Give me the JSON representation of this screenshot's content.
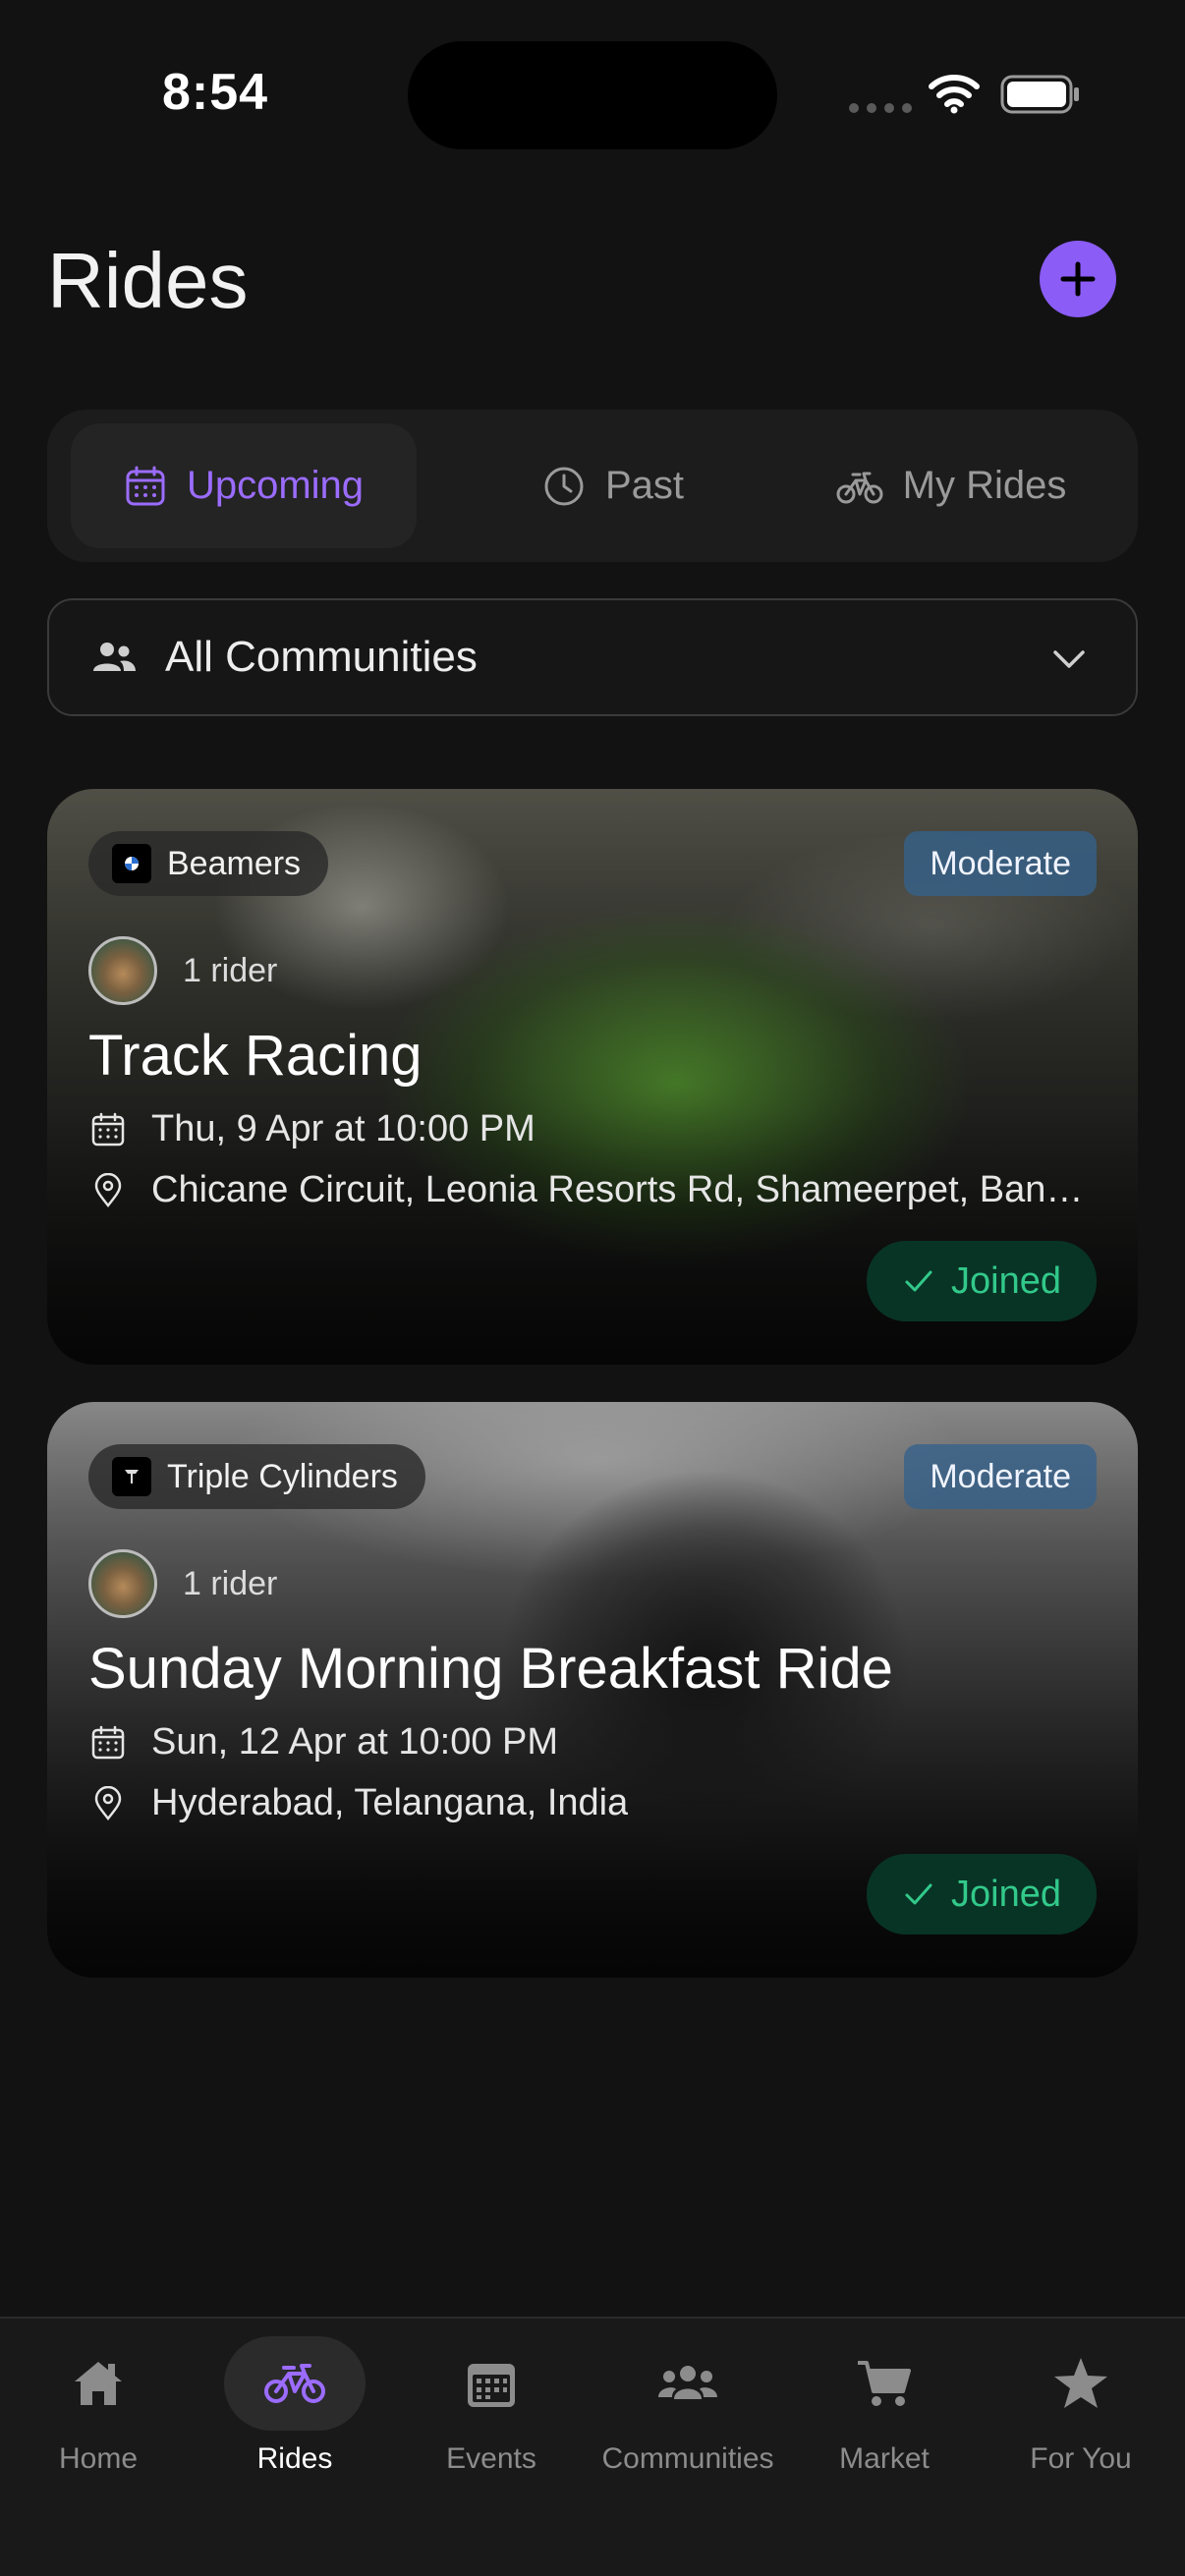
{
  "status_bar": {
    "time": "8:54"
  },
  "header": {
    "title": "Rides"
  },
  "tabs": [
    {
      "label": "Upcoming",
      "icon": "calendar-icon",
      "active": true
    },
    {
      "label": "Past",
      "icon": "clock-icon",
      "active": false
    },
    {
      "label": "My Rides",
      "icon": "bicycle-icon",
      "active": false
    }
  ],
  "community_filter": {
    "selected": "All Communities"
  },
  "rides": [
    {
      "community": "Beamers",
      "difficulty": "Moderate",
      "riders": "1 rider",
      "title": "Track Racing",
      "date": "Thu, 9 Apr at 10:00 PM",
      "location": "Chicane Circuit, Leonia Resorts Rd, Shameerpet, Bangalore",
      "status": "Joined"
    },
    {
      "community": "Triple Cylinders",
      "difficulty": "Moderate",
      "riders": "1 rider",
      "title": "Sunday Morning Breakfast Ride",
      "date": "Sun, 12 Apr at 10:00 PM",
      "location": "Hyderabad, Telangana, India",
      "status": "Joined"
    }
  ],
  "bottom_nav": [
    {
      "label": "Home",
      "icon": "home-icon",
      "active": false
    },
    {
      "label": "Rides",
      "icon": "bicycle-icon",
      "active": true
    },
    {
      "label": "Events",
      "icon": "calendar-icon",
      "active": false
    },
    {
      "label": "Communities",
      "icon": "people-icon",
      "active": false
    },
    {
      "label": "Market",
      "icon": "cart-icon",
      "active": false
    },
    {
      "label": "For You",
      "icon": "star-icon",
      "active": false
    }
  ],
  "colors": {
    "accent": "#8b5cf6",
    "background": "#121212",
    "joined_text": "#32c98a",
    "difficulty_badge": "#34628c"
  }
}
